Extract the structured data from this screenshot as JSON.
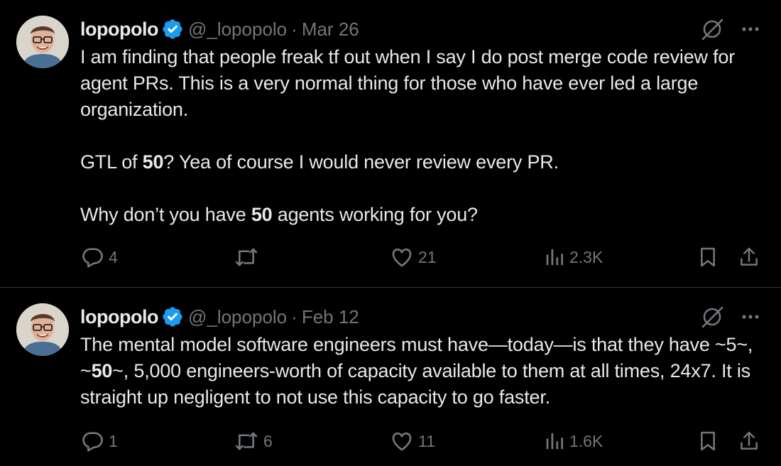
{
  "tweets": [
    {
      "author": {
        "display_name": "lopopolo",
        "handle": "@_lopopolo",
        "verified": true
      },
      "separator": "·",
      "date": "Mar 26",
      "body": {
        "para1": "I am finding that people freak tf out when I say I do post merge code review for agent PRs. This is a very normal thing for those who have ever led a large organization.",
        "para2_before": "GTL of ",
        "para2_bold": "50",
        "para2_after": "? Yea of course I would never review every PR.",
        "para3_before": "Why don’t you have ",
        "para3_bold": "50",
        "para3_after": " agents working for you?"
      },
      "stats": {
        "replies": "4",
        "reposts": "",
        "likes": "21",
        "views": "2.3K"
      }
    },
    {
      "author": {
        "display_name": "lopopolo",
        "handle": "@_lopopolo",
        "verified": true
      },
      "separator": "·",
      "date": "Feb 12",
      "body": {
        "text_before": "The mental model software engineers must have—today—is that they have ~5~, ~",
        "text_bold": "50",
        "text_after": "~, 5,000 engineers-worth of capacity available to them at all times, 24x7. It is straight up negligent to not use this capacity to go faster."
      },
      "stats": {
        "replies": "1",
        "reposts": "6",
        "likes": "11",
        "views": "1.6K"
      }
    }
  ],
  "icons": {
    "avatar": "avatar",
    "verified": "verified-badge-icon",
    "grok": "grok-icon",
    "more": "more-dots-icon",
    "reply": "reply-bubble-icon",
    "repost": "repost-icon",
    "like": "heart-icon",
    "views": "views-bar-icon",
    "bookmark": "bookmark-icon",
    "share": "share-upload-icon"
  },
  "colors": {
    "background": "#000000",
    "text_primary": "#e7e9ea",
    "text_secondary": "#71767b",
    "verified_blue": "#1d9bf0",
    "divider": "#2f3336"
  }
}
